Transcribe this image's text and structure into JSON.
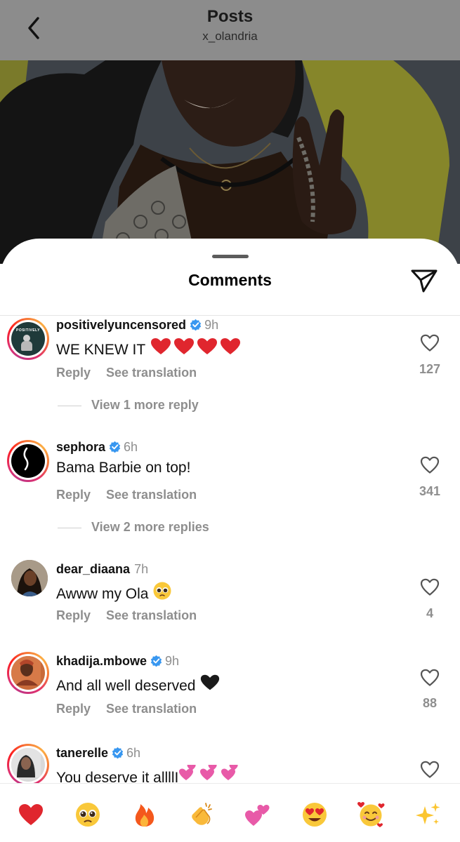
{
  "header": {
    "title": "Posts",
    "subtitle": "x_olandria",
    "back_icon": "chevron-left-icon"
  },
  "sheet": {
    "title": "Comments",
    "share_icon": "send-icon"
  },
  "colors": {
    "verified": "#3897f0",
    "muted": "#8e8e8e",
    "heart_red": "#e0262e",
    "story_ring": "#e1306c"
  },
  "comments": [
    {
      "username": "positivelyuncensored",
      "verified": true,
      "time": "9h",
      "text": "WE KNEW IT",
      "emoji": "heart-red-x4",
      "likes": "127",
      "reply_label": "Reply",
      "translate_label": "See translation",
      "view_more": "View 1 more reply",
      "avatar_text": "POSITIVELY",
      "story_ring": true
    },
    {
      "username": "sephora",
      "verified": true,
      "time": "6h",
      "text": "Bama Barbie on top!",
      "likes": "341",
      "reply_label": "Reply",
      "translate_label": "See translation",
      "view_more": "View 2 more replies",
      "story_ring": true
    },
    {
      "username": "dear_diaana",
      "verified": false,
      "time": "7h",
      "text": "Awww my Ola",
      "emoji": "pleading-face",
      "likes": "4",
      "reply_label": "Reply",
      "translate_label": "See translation",
      "story_ring": false
    },
    {
      "username": "khadija.mbowe",
      "verified": true,
      "time": "9h",
      "text": "And all well deserved",
      "emoji": "black-heart",
      "likes": "88",
      "reply_label": "Reply",
      "translate_label": "See translation",
      "story_ring": true
    },
    {
      "username": "tanerelle",
      "verified": true,
      "time": "6h",
      "text": "You deserve it allllI",
      "emoji": "two-hearts-x3",
      "story_ring": true
    }
  ],
  "emoji_bar": [
    "red-heart-emoji",
    "pleading-face-emoji",
    "fire-emoji",
    "clapping-hands-emoji",
    "two-hearts-emoji",
    "heart-eyes-emoji",
    "smiling-hearts-emoji",
    "sparkles-emoji"
  ]
}
